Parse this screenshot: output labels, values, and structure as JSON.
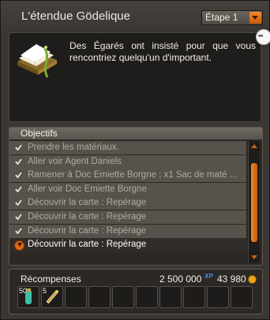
{
  "window": {
    "title": "L'étendue Gödelique"
  },
  "step_select": {
    "value": "Étape 1"
  },
  "description": {
    "text": "Des Égarés ont insisté pour que vous rencontriez quelqu'un d'important.",
    "icon": "quest-book-icon"
  },
  "objectives": {
    "header": "Objectifs",
    "items": [
      {
        "label": "Prendre les matériaux.",
        "status": "done"
      },
      {
        "label": "Aller voir Agent Daniels",
        "status": "done"
      },
      {
        "label": "Ramener à Doc Emiette Borgne : x1 Sac de maté ...",
        "status": "done"
      },
      {
        "label": "Aller voir Doc Emiette Borgne",
        "status": "done"
      },
      {
        "label": "Découvrir la carte : Repérage",
        "status": "done"
      },
      {
        "label": "Découvrir la carte : Repérage",
        "status": "done"
      },
      {
        "label": "Découvrir la carte : Repérage",
        "status": "done"
      },
      {
        "label": "Découvrir la carte : Repérage",
        "status": "current"
      }
    ]
  },
  "rewards": {
    "title": "Récompenses",
    "kamas": "2 500 000",
    "xp_unit": "XP",
    "xp": "43 980",
    "items": [
      {
        "qty": "50",
        "icon": "potion-icon"
      },
      {
        "qty": "5",
        "icon": "scroll-icon"
      },
      {
        "qty": ""
      },
      {
        "qty": ""
      },
      {
        "qty": ""
      },
      {
        "qty": ""
      },
      {
        "qty": ""
      },
      {
        "qty": ""
      },
      {
        "qty": ""
      },
      {
        "qty": ""
      }
    ]
  },
  "colors": {
    "accent": "#e06a12",
    "panel": "#2b2825",
    "row": "#56524c"
  }
}
